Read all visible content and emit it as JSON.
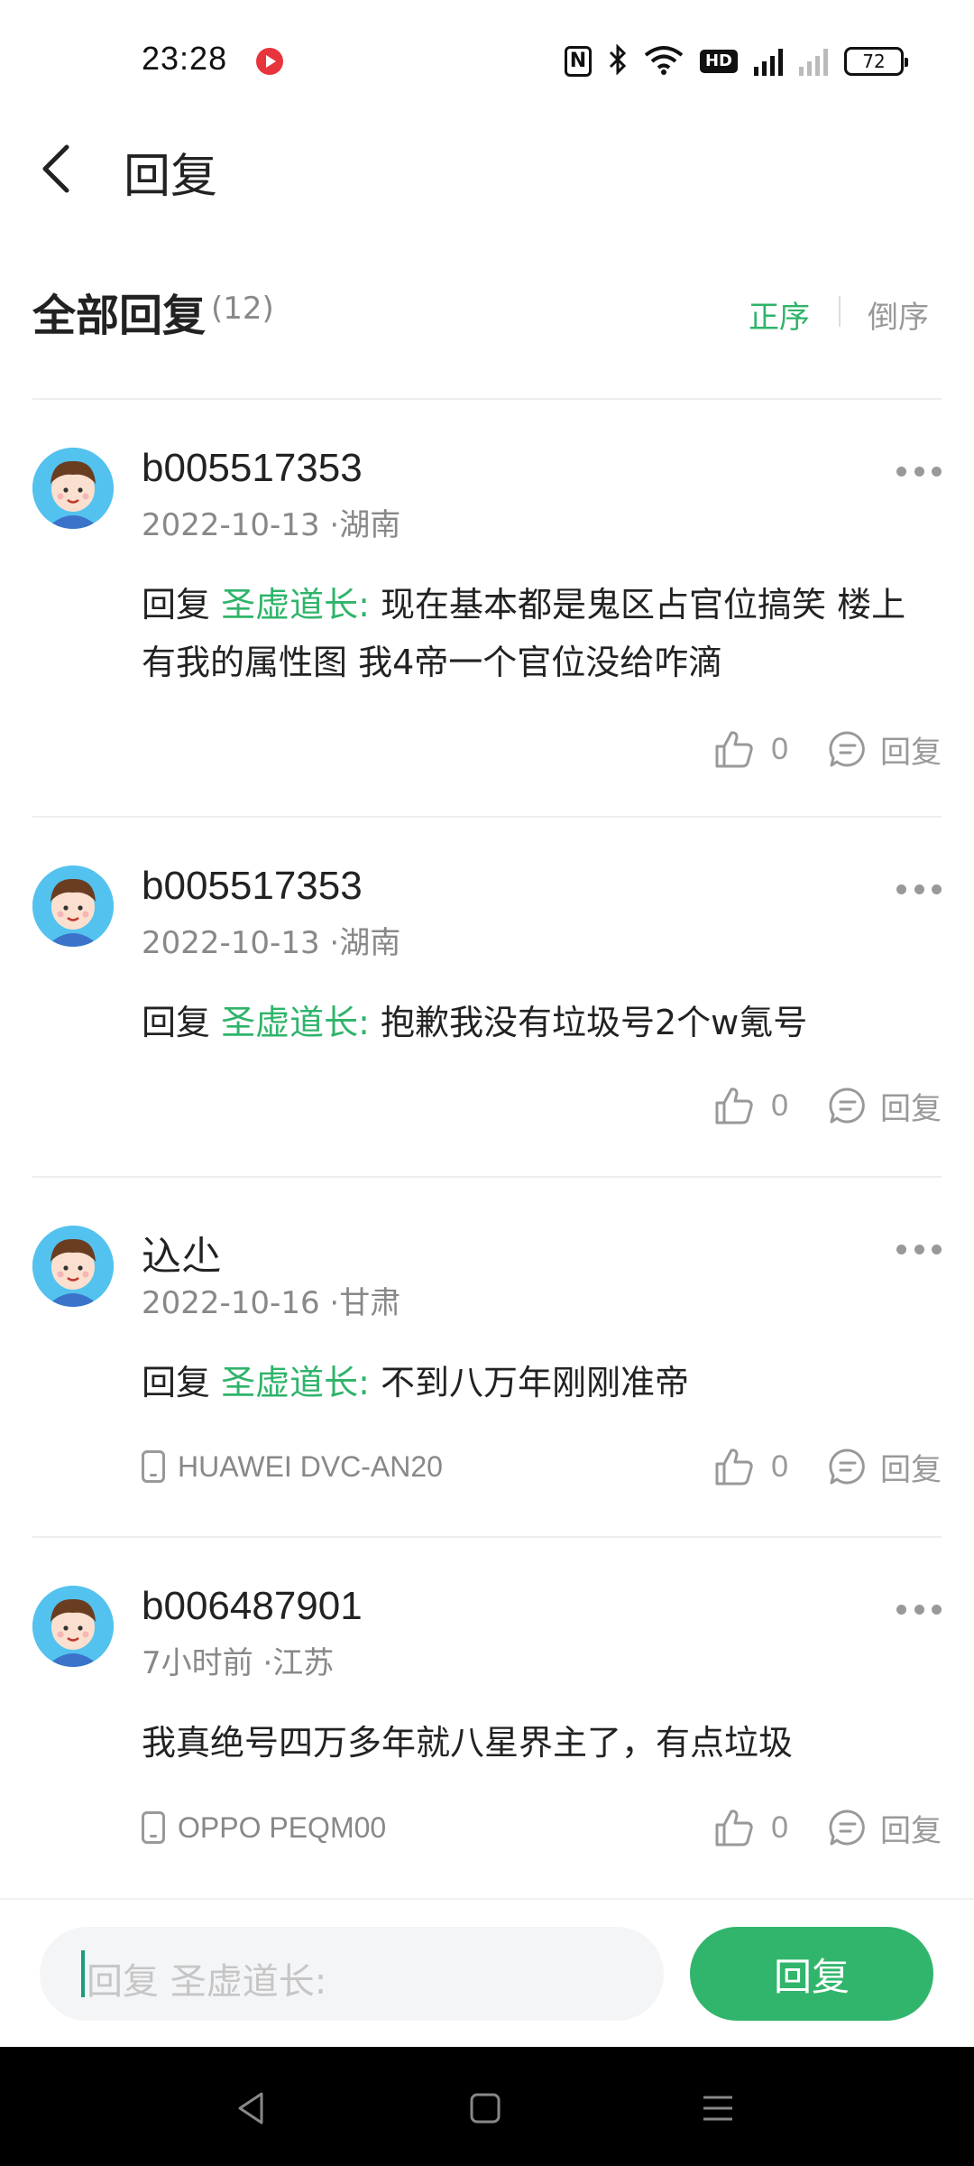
{
  "status_bar": {
    "time": "23:28",
    "network": "4G",
    "hd_label": "HD",
    "nfc_label": "N",
    "battery": "72"
  },
  "header": {
    "title": "回复"
  },
  "section": {
    "title": "全部回复",
    "count": "(12)",
    "sort_asc": "正序",
    "sort_desc": "倒序",
    "active_sort": "正序"
  },
  "comments": [
    {
      "user": "b005517353",
      "date": "2022-10-13 ·湖南",
      "prefix": "回复 ",
      "mention": "圣虚道长:",
      "text": " 现在基本都是鬼区占官位搞笑  楼上有我的属性图  我4帝一个官位没给咋滴",
      "device": "",
      "likes": "0",
      "reply_label": "回复"
    },
    {
      "user": "b005517353",
      "date": "2022-10-13 ·湖南",
      "prefix": "回复 ",
      "mention": "圣虚道长:",
      "text": " 抱歉我没有垃圾号2个w氪号",
      "device": "",
      "likes": "0",
      "reply_label": "回复"
    },
    {
      "user": "込尐",
      "date": "2022-10-16 ·甘肃",
      "prefix": "回复 ",
      "mention": "圣虚道长:",
      "text": " 不到八万年刚刚准帝",
      "device": "HUAWEI DVC-AN20",
      "likes": "0",
      "reply_label": "回复"
    },
    {
      "user": "b006487901",
      "date": "7小时前 ·江苏",
      "prefix": "",
      "mention": "",
      "text": "我真绝号四万多年就八星界主了，有点垃圾",
      "device": "OPPO PEQM00",
      "likes": "0",
      "reply_label": "回复"
    }
  ],
  "input_bar": {
    "placeholder": "回复 圣虚道长:",
    "send_label": "回复"
  },
  "colors": {
    "accent_green": "#2fb46a",
    "send_button": "#31b56c",
    "avatar_bg": "#53c2ee",
    "muted_text": "#888888"
  },
  "icons": [
    "back-arrow-icon",
    "more-icon",
    "thumb-up-icon",
    "comment-bubble-icon",
    "phone-icon",
    "nav-back-icon",
    "nav-home-icon",
    "nav-menu-icon"
  ]
}
